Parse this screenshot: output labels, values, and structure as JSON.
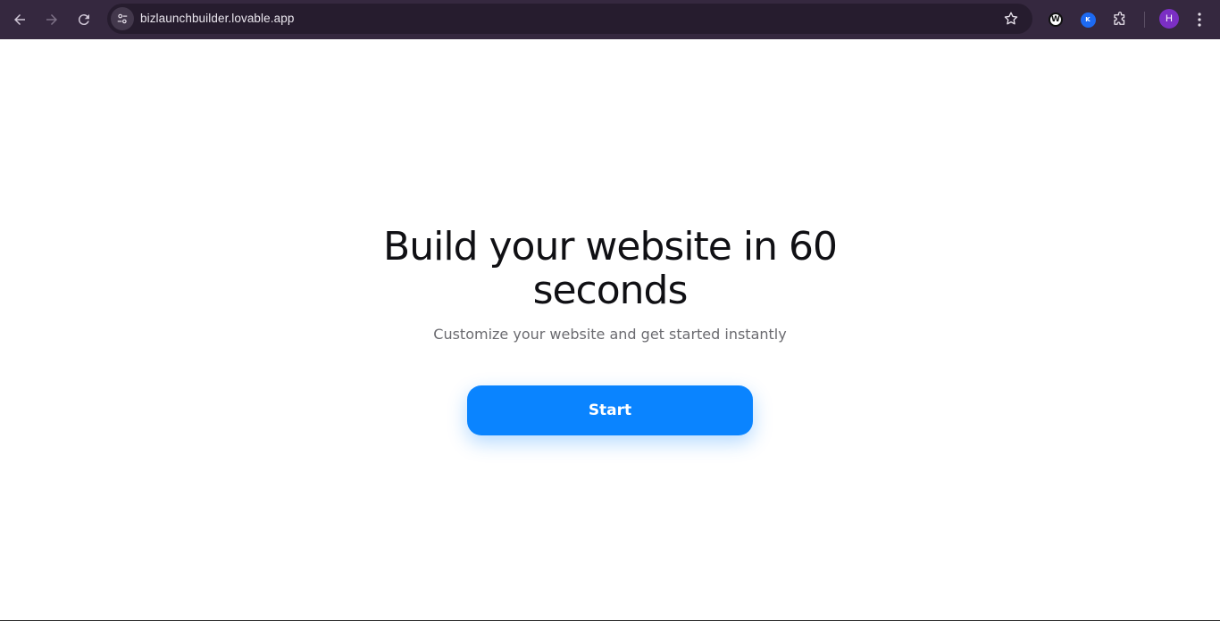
{
  "browser": {
    "url": "bizlaunchbuilder.lovable.app",
    "extensions": [
      {
        "name": "w-extension-icon",
        "glyph": "W"
      },
      {
        "name": "blue-extension-icon",
        "glyph": "K"
      }
    ],
    "profile_initial": "H",
    "colors": {
      "toolbar": "#35283f",
      "omnibox": "#261c2e",
      "avatar": "#7b2fc4"
    }
  },
  "hero": {
    "title": "Build your website in 60 seconds",
    "subtitle": "Customize your website and get started instantly",
    "start_label": "Start",
    "accent": "#0a84ff"
  }
}
